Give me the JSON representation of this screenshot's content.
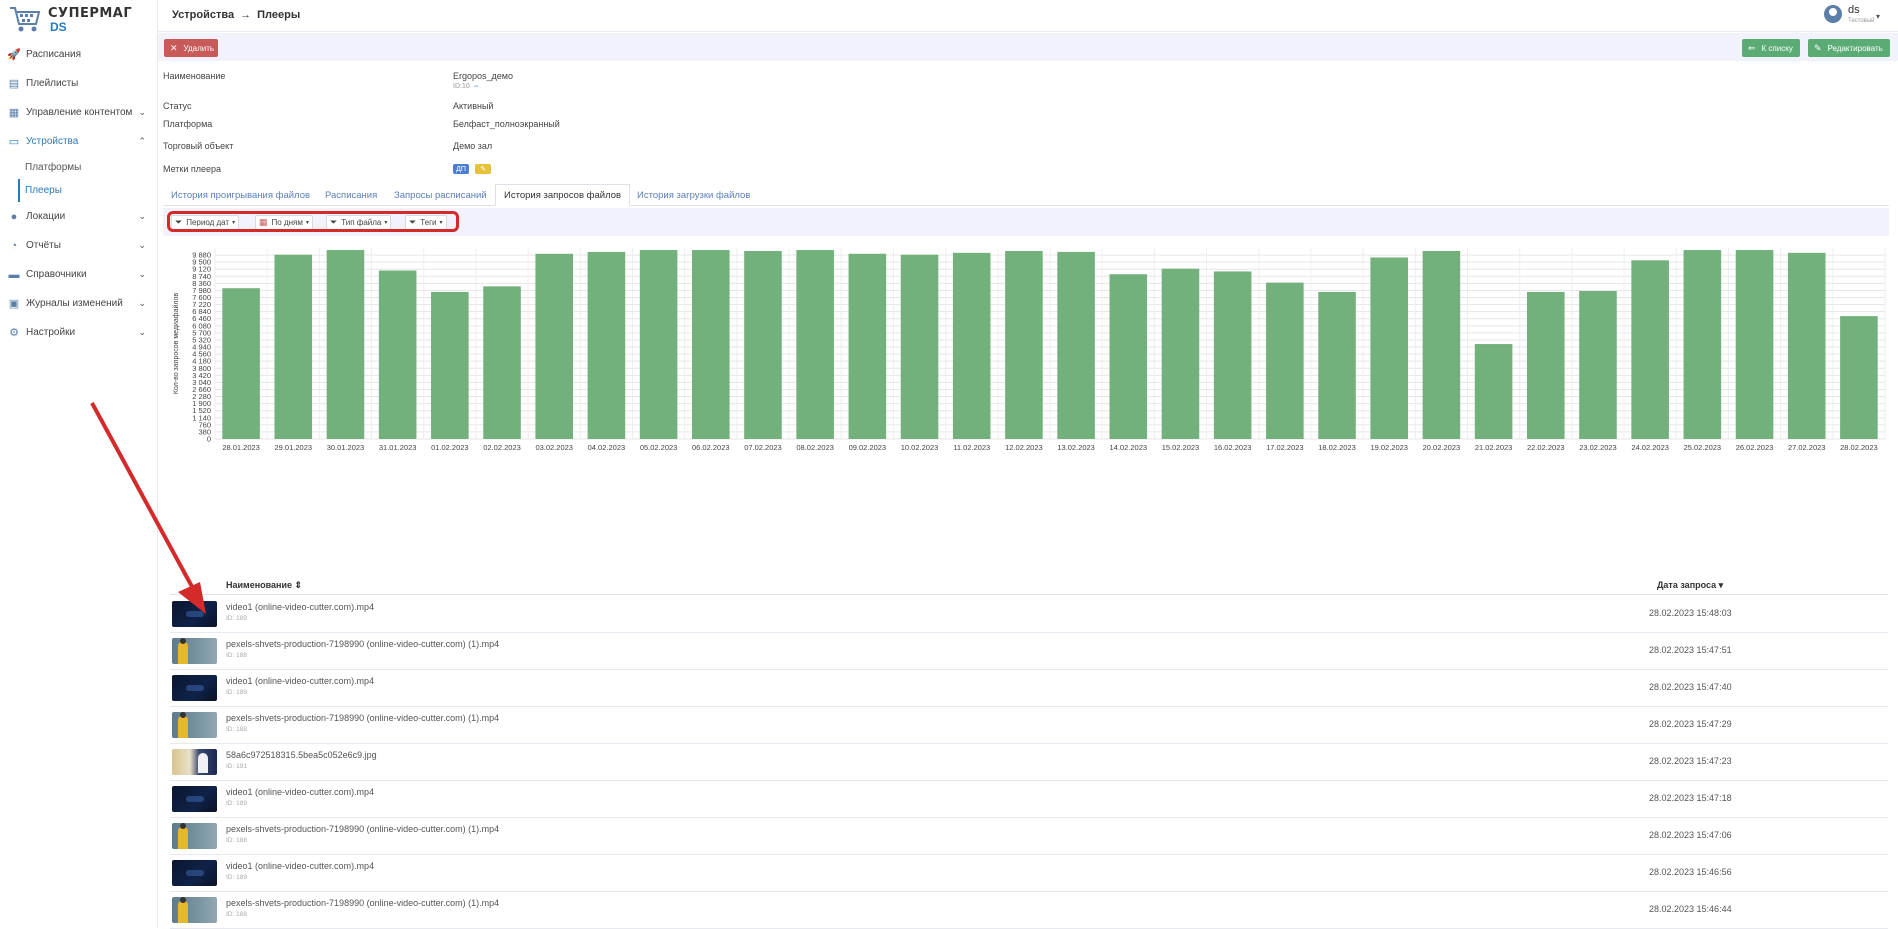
{
  "app": {
    "brand_top": "СУПЕРМАГ",
    "brand_bottom": "DS"
  },
  "sidebar": {
    "items": [
      {
        "label": "Расписания",
        "icon": "rocket-icon",
        "glyph": "🚀"
      },
      {
        "label": "Плейлисты",
        "icon": "playlist-icon",
        "glyph": "▤"
      },
      {
        "label": "Управление контентом",
        "icon": "content-icon",
        "glyph": "▦",
        "chevron": "⌄"
      },
      {
        "label": "Устройства",
        "icon": "monitor-icon",
        "glyph": "▭",
        "chevron": "⌃"
      },
      {
        "label": "Локации",
        "icon": "location-icon",
        "glyph": "●",
        "chevron": "⌄"
      },
      {
        "label": "Отчёты",
        "icon": "chart-pie-icon",
        "glyph": "◔",
        "chevron": "⌄"
      },
      {
        "label": "Справочники",
        "icon": "folder-icon",
        "glyph": "▬",
        "chevron": "⌄"
      },
      {
        "label": "Журналы изменений",
        "icon": "journal-icon",
        "glyph": "▣",
        "chevron": "⌄"
      },
      {
        "label": "Настройки",
        "icon": "gear-icon",
        "glyph": "⚙",
        "chevron": "⌄"
      }
    ],
    "sub_items": [
      {
        "label": "Платформы"
      },
      {
        "label": "Плееры"
      }
    ]
  },
  "topbar": {
    "crumb_1": "Устройства",
    "crumb_sep": "→",
    "crumb_2": "Плееры",
    "user_name": "ds",
    "user_role": "Тестовый",
    "user_caret": "▾"
  },
  "actions": {
    "delete_label": "Удалить",
    "delete_icon": "✕",
    "back_label": "К списку",
    "back_icon": "⇐",
    "edit_label": "Редактировать",
    "edit_icon": "✎"
  },
  "player": {
    "name_label": "Наименование",
    "name_value": "Ergopos_демо",
    "id_text": "ID:10",
    "id_link": "⇔",
    "status_label": "Статус",
    "status_value": "Активный",
    "platform_label": "Платформа",
    "platform_value": "Белфаст_полноэкранный",
    "store_label": "Торговый объект",
    "store_value": "Демо зал",
    "tags_label": "Метки плеера",
    "tag_1": "ДП",
    "tag_2": "✎"
  },
  "tabs": [
    {
      "label": "История проигрывания файлов"
    },
    {
      "label": "Расписания"
    },
    {
      "label": "Запросы расписаний"
    },
    {
      "label": "История запросов файлов"
    },
    {
      "label": "История загрузки файлов"
    }
  ],
  "filters": [
    {
      "label": "Период дат",
      "icon": "filter-icon",
      "glyph": "⏷"
    },
    {
      "label": "По дням",
      "icon": "calendar-icon",
      "glyph": "▦"
    },
    {
      "label": "Тип файла",
      "icon": "filter-icon",
      "glyph": "⏷"
    },
    {
      "label": "Теги",
      "icon": "filter-icon",
      "glyph": "⏷"
    }
  ],
  "filter_caret": "▾",
  "chart_data": {
    "type": "bar",
    "ylabel": "Кол-во запросов медиафайлов",
    "ylim": [
      0,
      10260
    ],
    "yticks": [
      0,
      380,
      760,
      1140,
      1520,
      1900,
      2280,
      2660,
      3040,
      3420,
      3800,
      4180,
      4560,
      4940,
      5320,
      5700,
      6080,
      6460,
      6840,
      7220,
      7600,
      7980,
      8360,
      8740,
      9120,
      9500,
      9880
    ],
    "ytick_labels": [
      "0",
      "380",
      "760",
      "1 140",
      "1 520",
      "1 900",
      "2 280",
      "2 660",
      "3 040",
      "3 420",
      "3 800",
      "4 180",
      "4 560",
      "4 940",
      "5 320",
      "5 700",
      "6 080",
      "6 460",
      "6 840",
      "7 220",
      "7 600",
      "7 980",
      "8 360",
      "8 740",
      "9 120",
      "9 500",
      "9 880"
    ],
    "categories": [
      "28.01.2023",
      "29.01.2023",
      "30.01.2023",
      "31.01.2023",
      "01.02.2023",
      "02.02.2023",
      "03.02.2023",
      "04.02.2023",
      "05.02.2023",
      "06.02.2023",
      "07.02.2023",
      "08.02.2023",
      "09.02.2023",
      "10.02.2023",
      "11.02.2023",
      "12.02.2023",
      "13.02.2023",
      "14.02.2023",
      "15.02.2023",
      "16.02.2023",
      "17.02.2023",
      "18.02.2023",
      "19.02.2023",
      "20.02.2023",
      "21.02.2023",
      "22.02.2023",
      "23.02.2023",
      "24.02.2023",
      "25.02.2023",
      "26.02.2023",
      "27.02.2023",
      "28.02.2023"
    ],
    "values": [
      8100,
      9900,
      10150,
      9050,
      7900,
      8200,
      9950,
      10050,
      10150,
      10150,
      10100,
      10150,
      9950,
      9900,
      10000,
      10100,
      10050,
      8850,
      9150,
      9000,
      8400,
      7900,
      9750,
      10100,
      5100,
      7900,
      7950,
      9600,
      10150,
      10150,
      10000,
      6600
    ],
    "bar_color": "#72b17b",
    "grid": true
  },
  "table": {
    "col_name": "Наименование ⇕",
    "col_date": "Дата запроса ▾",
    "rows": [
      {
        "name": "video1 (online-video-cutter.com).mp4",
        "id": "ID: 189",
        "date": "28.02.2023 15:48:03",
        "thumb": "video"
      },
      {
        "name": "pexels-shvets-production-7198990 (online-video-cutter.com) (1).mp4",
        "id": "ID: 188",
        "date": "28.02.2023 15:47:51",
        "thumb": "pexels"
      },
      {
        "name": "video1 (online-video-cutter.com).mp4",
        "id": "ID: 189",
        "date": "28.02.2023 15:47:40",
        "thumb": "video"
      },
      {
        "name": "pexels-shvets-production-7198990 (online-video-cutter.com) (1).mp4",
        "id": "ID: 188",
        "date": "28.02.2023 15:47:29",
        "thumb": "pexels"
      },
      {
        "name": "58a6c972518315.5bea5c052e6c9.jpg",
        "id": "ID: 191",
        "date": "28.02.2023 15:47:23",
        "thumb": "jpg"
      },
      {
        "name": "video1 (online-video-cutter.com).mp4",
        "id": "ID: 189",
        "date": "28.02.2023 15:47:18",
        "thumb": "video"
      },
      {
        "name": "pexels-shvets-production-7198990 (online-video-cutter.com) (1).mp4",
        "id": "ID: 188",
        "date": "28.02.2023 15:47:06",
        "thumb": "pexels"
      },
      {
        "name": "video1 (online-video-cutter.com).mp4",
        "id": "ID: 189",
        "date": "28.02.2023 15:46:56",
        "thumb": "video"
      },
      {
        "name": "pexels-shvets-production-7198990 (online-video-cutter.com) (1).mp4",
        "id": "ID: 188",
        "date": "28.02.2023 15:46:44",
        "thumb": "pexels"
      }
    ]
  },
  "colors": {
    "accent": "#2a7ab8",
    "annotation": "#d42a2a",
    "success": "#5bab74",
    "danger": "#c85a5a"
  }
}
